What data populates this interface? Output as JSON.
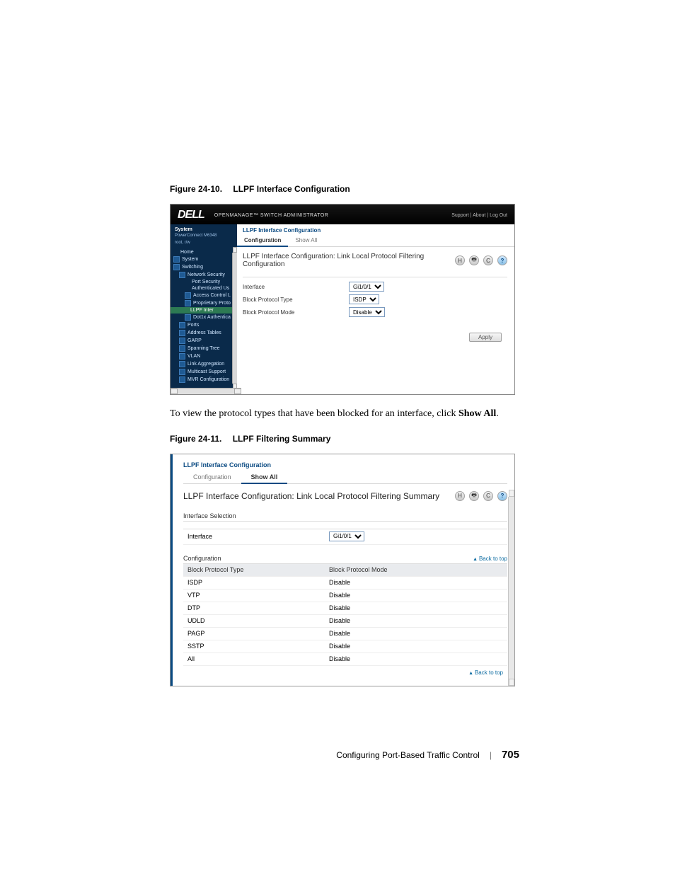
{
  "figure1": {
    "caption_num": "Figure 24-10.",
    "caption_title": "LLPF Interface Configuration"
  },
  "figure2": {
    "caption_num": "Figure 24-11.",
    "caption_title": "LLPF Filtering Summary"
  },
  "body_paragraph": {
    "pre": "To view the protocol types that have been blocked for an interface, click ",
    "bold": "Show All",
    "post": "."
  },
  "app": {
    "brand": "DELL",
    "product": "OPENMANAGE™ SWITCH ADMINISTRATOR",
    "top_links": "Support | About | Log Out",
    "system_label": "System",
    "device_model": "PowerConnect M6348",
    "user_line": "root, r/w",
    "nav": {
      "home": "Home",
      "system": "System",
      "switching": "Switching",
      "net_sec": "Network Security",
      "port_sec": "Port Security",
      "auth_us": "Authenticated Us",
      "acl": "Access Control L",
      "prop_proto": "Proprietary Proto",
      "llpf_inter": "LLPF Inter",
      "dot1x": "Dot1x Authentica",
      "ports": "Ports",
      "addr_tables": "Address Tables",
      "garp": "GARP",
      "span_tree": "Spanning Tree",
      "vlan": "VLAN",
      "link_agg": "Link Aggregation",
      "mcast": "Multicast Support",
      "mvr": "MVR Configuration"
    },
    "breadcrumb": "LLPF Interface Configuration",
    "tabs": {
      "conf": "Configuration",
      "showall": "Show All"
    },
    "pane_title": "LLPF Interface Configuration: Link Local Protocol Filtering Configuration",
    "labels": {
      "interface": "Interface",
      "bptype": "Block Protocol Type",
      "bpmode": "Block Protocol Mode"
    },
    "values": {
      "interface": "Gi1/0/1",
      "bptype": "ISDP",
      "bpmode": "Disable"
    },
    "apply": "Apply"
  },
  "summary": {
    "breadcrumb": "LLPF Interface Configuration",
    "tabs": {
      "conf": "Configuration",
      "showall": "Show All"
    },
    "title": "LLPF Interface Configuration: Link Local Protocol Filtering Summary",
    "sections": {
      "iface_sel": "Interface Selection",
      "interface_label": "Interface",
      "interface_value": "Gi1/0/1",
      "config": "Configuration",
      "back": "Back to top"
    },
    "columns": {
      "c1": "Block Protocol Type",
      "c2": "Block Protocol Mode"
    },
    "rows": [
      {
        "type": "ISDP",
        "mode": "Disable"
      },
      {
        "type": "VTP",
        "mode": "Disable"
      },
      {
        "type": "DTP",
        "mode": "Disable"
      },
      {
        "type": "UDLD",
        "mode": "Disable"
      },
      {
        "type": "PAGP",
        "mode": "Disable"
      },
      {
        "type": "SSTP",
        "mode": "Disable"
      },
      {
        "type": "All",
        "mode": "Disable"
      }
    ]
  },
  "icons": {
    "save": "H",
    "print": "🖶",
    "refresh": "C",
    "help": "?"
  },
  "footer": {
    "chapter": "Configuring Port-Based Traffic Control",
    "page": "705"
  }
}
